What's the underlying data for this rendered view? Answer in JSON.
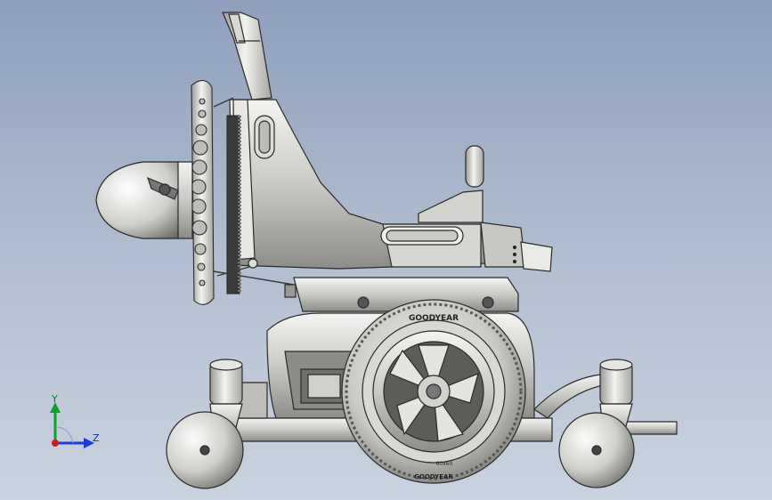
{
  "viewport": {
    "name": "CAD 3D model view",
    "background_top": "#8f9fbc",
    "background_bottom": "#c9d2df"
  },
  "model": {
    "tire_brand": "GOODYEAR",
    "tire_brand_bottom": "GOODYEAR",
    "tire_size_text": "60x60"
  },
  "triad": {
    "y_label": "Y",
    "z_label": "Z",
    "y_color": "#0aa12e",
    "z_color": "#1d3bd6",
    "x_color": "#d21a1a"
  }
}
